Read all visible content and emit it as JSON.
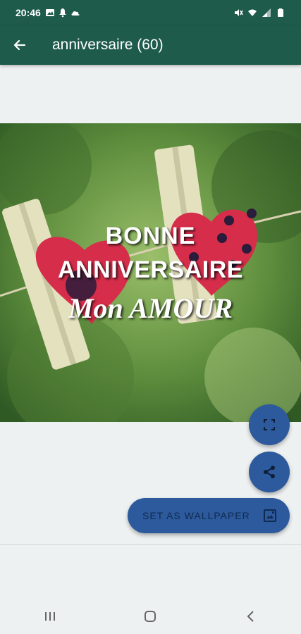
{
  "status_bar": {
    "time": "20:46",
    "icons_left": [
      "image-icon",
      "notification-icon",
      "cloud-icon"
    ],
    "icons_right": [
      "mute-icon",
      "wifi-icon",
      "signal-icon",
      "battery-icon"
    ]
  },
  "app_bar": {
    "title": "anniversaire (60)",
    "back_icon": "arrow-left-icon"
  },
  "image": {
    "line1": "BONNE",
    "line2": "ANNIVERSAIRE",
    "line3": "Mon AMOUR"
  },
  "actions": {
    "expand_icon": "expand-icon",
    "share_icon": "share-icon",
    "set_wallpaper_label": "SET AS WALLPAPER",
    "wallpaper_icon": "wallpaper-icon"
  },
  "colors": {
    "app_bar": "#1e5b4a",
    "fab": "#2c5a9c",
    "background": "#eef1f1"
  },
  "nav_bar": {
    "buttons": [
      "recents-icon",
      "home-icon",
      "back-icon"
    ]
  }
}
